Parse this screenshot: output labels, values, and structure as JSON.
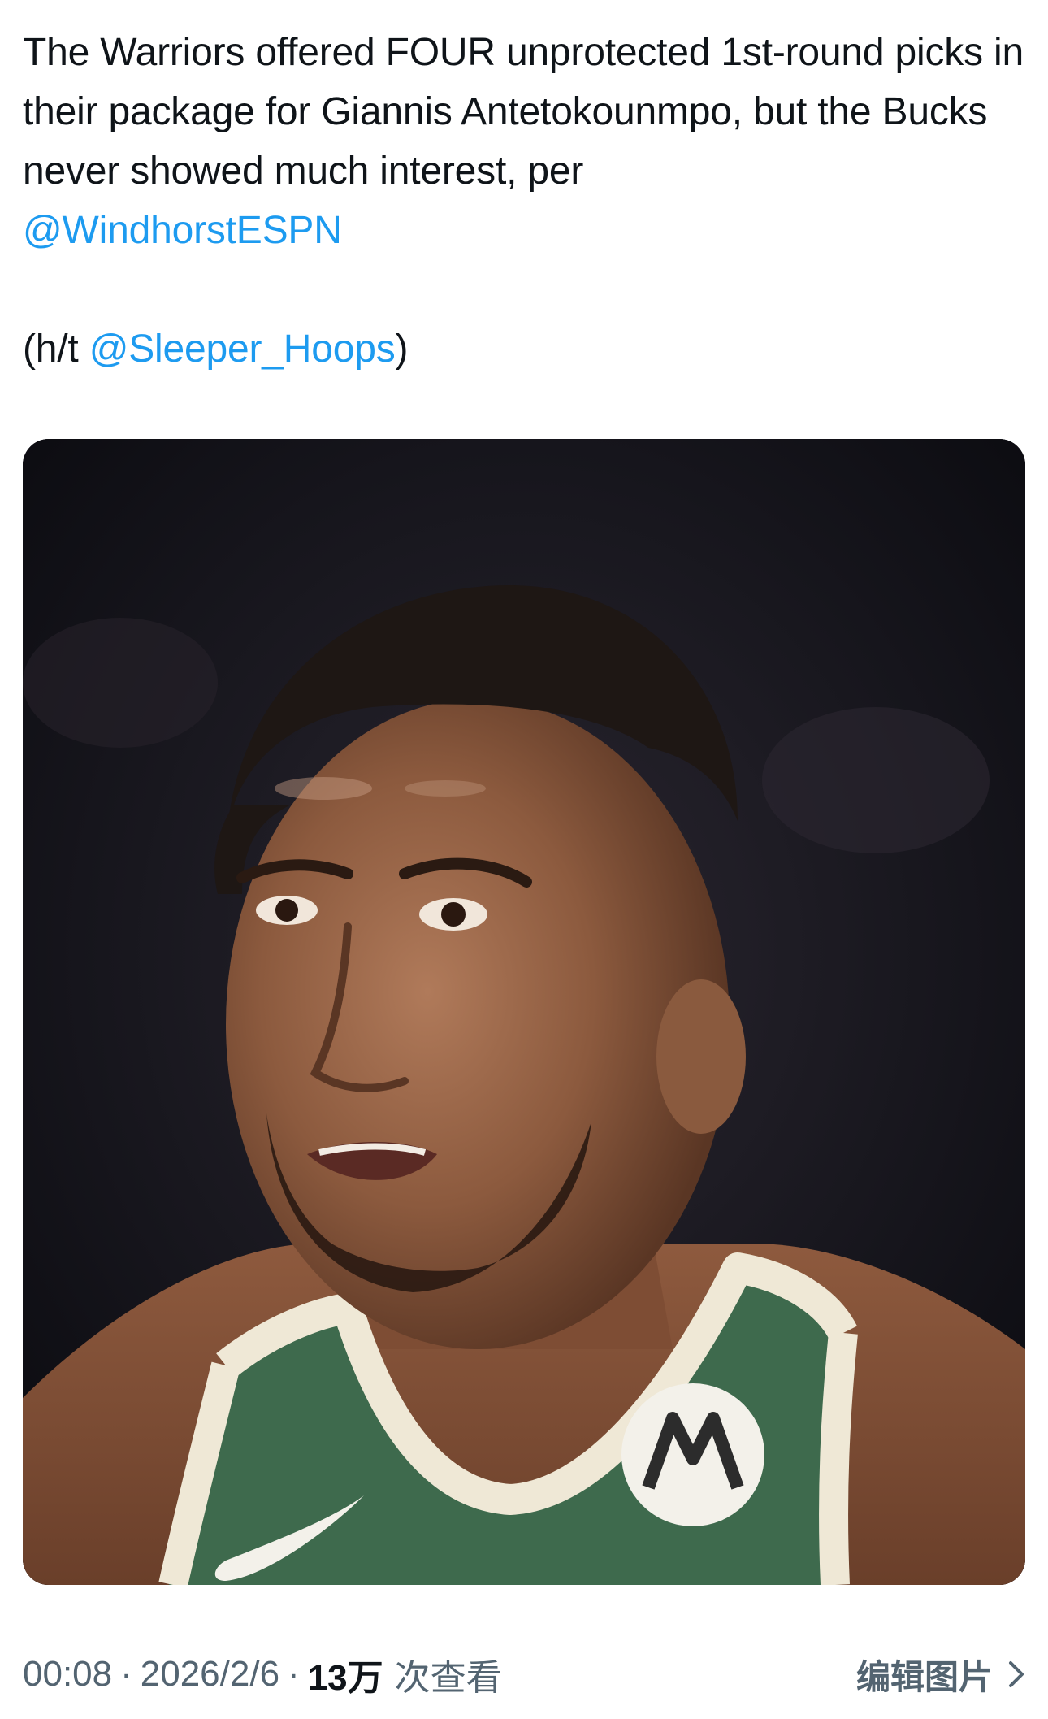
{
  "tweet": {
    "line1_before": "The Warriors offered FOUR unprotected 1st-round picks in their package for Giannis Antetokounmpo, but the Bucks never showed much interest, per",
    "mention_windhorst": "@WindhorstESPN",
    "ht_prefix": "(h/t ",
    "mention_sleeper": "@Sleeper_Hoops",
    "ht_suffix": ")"
  },
  "media": {
    "jersey_logo_glyph": "M"
  },
  "meta": {
    "time": "00:08",
    "separator": "·",
    "date": "2026/2/6",
    "views_count": "13万",
    "views_label": "次查看"
  },
  "actions": {
    "edit_image_label": "编辑图片"
  },
  "colors": {
    "link": "#1d9bf0",
    "text": "#0f1419",
    "secondary": "#536471",
    "jersey_green": "#3e6a4d",
    "jersey_trim": "#efe8d6"
  }
}
